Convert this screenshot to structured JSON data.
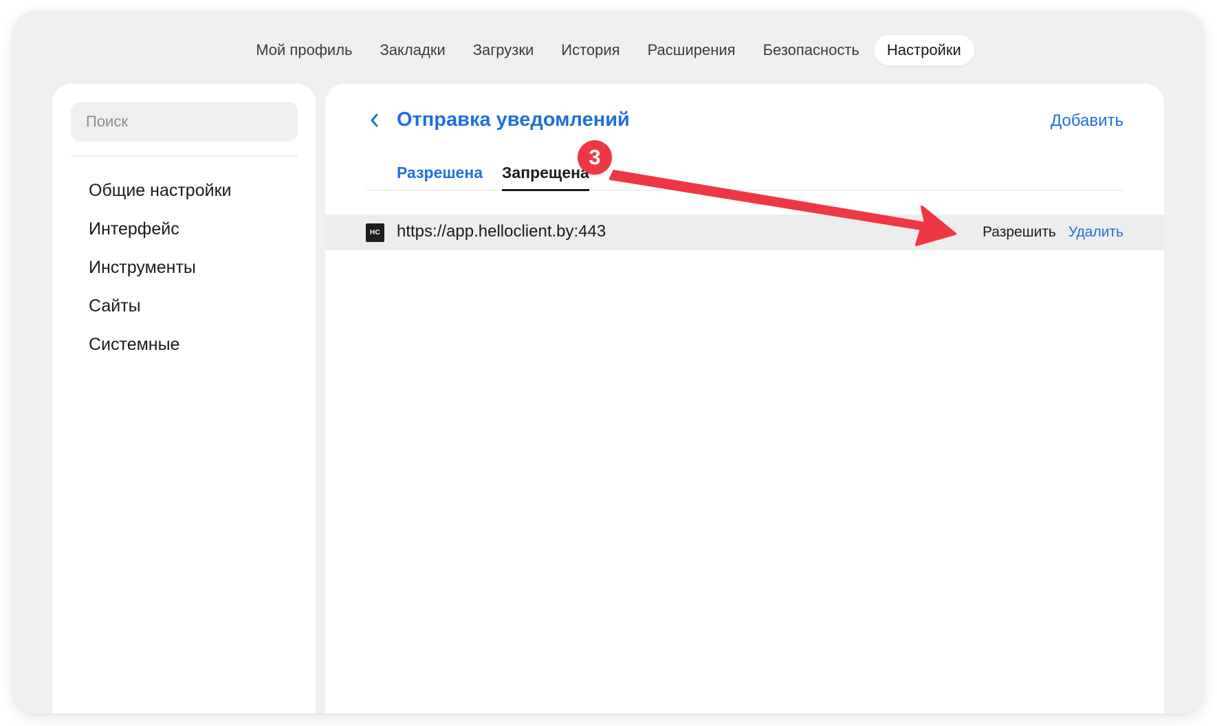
{
  "nav": {
    "tabs": [
      {
        "label": "Мой профиль"
      },
      {
        "label": "Закладки"
      },
      {
        "label": "Загрузки"
      },
      {
        "label": "История"
      },
      {
        "label": "Расширения"
      },
      {
        "label": "Безопасность"
      },
      {
        "label": "Настройки",
        "active": true
      }
    ]
  },
  "sidebar": {
    "search_placeholder": "Поиск",
    "items": [
      {
        "label": "Общие настройки"
      },
      {
        "label": "Интерфейс"
      },
      {
        "label": "Инструменты"
      },
      {
        "label": "Сайты"
      },
      {
        "label": "Системные"
      }
    ]
  },
  "main": {
    "title": "Отправка уведомлений",
    "add_label": "Добавить",
    "tabs": [
      {
        "label": "Разрешена"
      },
      {
        "label": "Запрещена",
        "active": true
      }
    ],
    "sites": [
      {
        "favicon_text": "HC",
        "url": "https://app.helloclient.by:443",
        "allow_label": "Разрешить",
        "delete_label": "Удалить"
      }
    ]
  },
  "annotation": {
    "step_number": "3",
    "color": "#ee3743"
  },
  "colors": {
    "accent": "#1f6fdc",
    "background": "#efefee",
    "annotation": "#ee3743"
  },
  "icons": {
    "back": "chevron-left-icon",
    "favicon": "site-favicon"
  }
}
